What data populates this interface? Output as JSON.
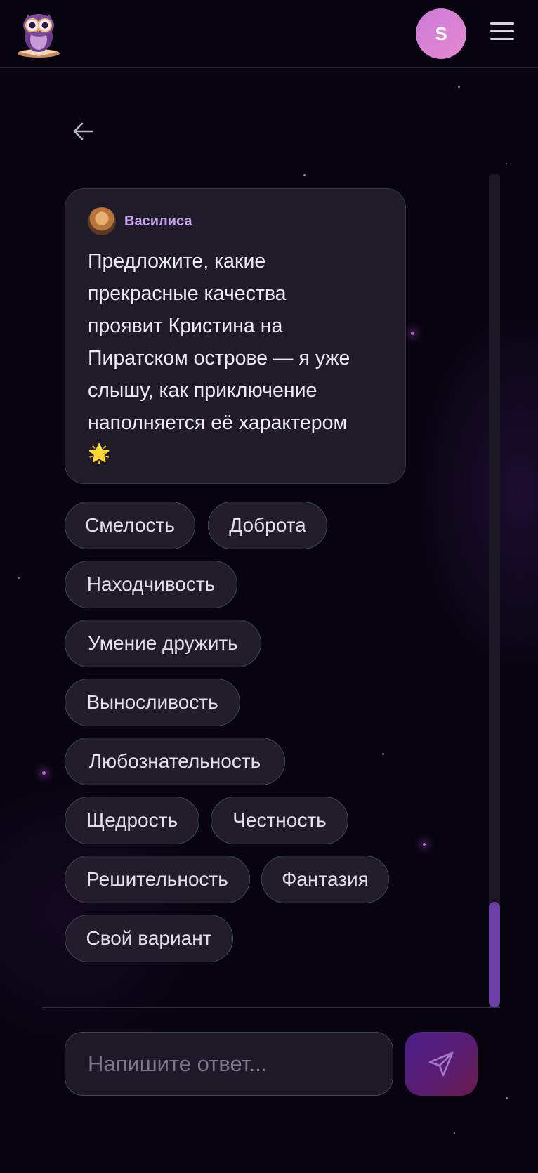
{
  "header": {
    "logo_icon": "owl-logo-icon",
    "avatar_initial": "S",
    "menu_icon": "hamburger-menu-icon"
  },
  "nav": {
    "back_icon": "arrow-left-icon"
  },
  "message": {
    "sender_name": "Василиса",
    "line1": "Предложите, какие",
    "line2": "прекрасные качества",
    "line3": "проявит Кристина на",
    "line4": "Пиратском острове — я уже",
    "line5": "слышу, как приключение",
    "line6": "наполняется её характером",
    "emoji": "🌟"
  },
  "options": [
    "Смелость",
    "Доброта",
    "Находчивость",
    "Умение дружить",
    "Выносливость",
    "Любознательность",
    "Щедрость",
    "Честность",
    "Решительность",
    "Фантазия",
    "Свой вариант"
  ],
  "input": {
    "placeholder": "Напишите ответ..."
  },
  "send_icon": "paper-plane-send-icon",
  "colors": {
    "accent": "#6b3fa6",
    "avatar": "#d983d6",
    "sender_name": "#c7a2ef"
  }
}
